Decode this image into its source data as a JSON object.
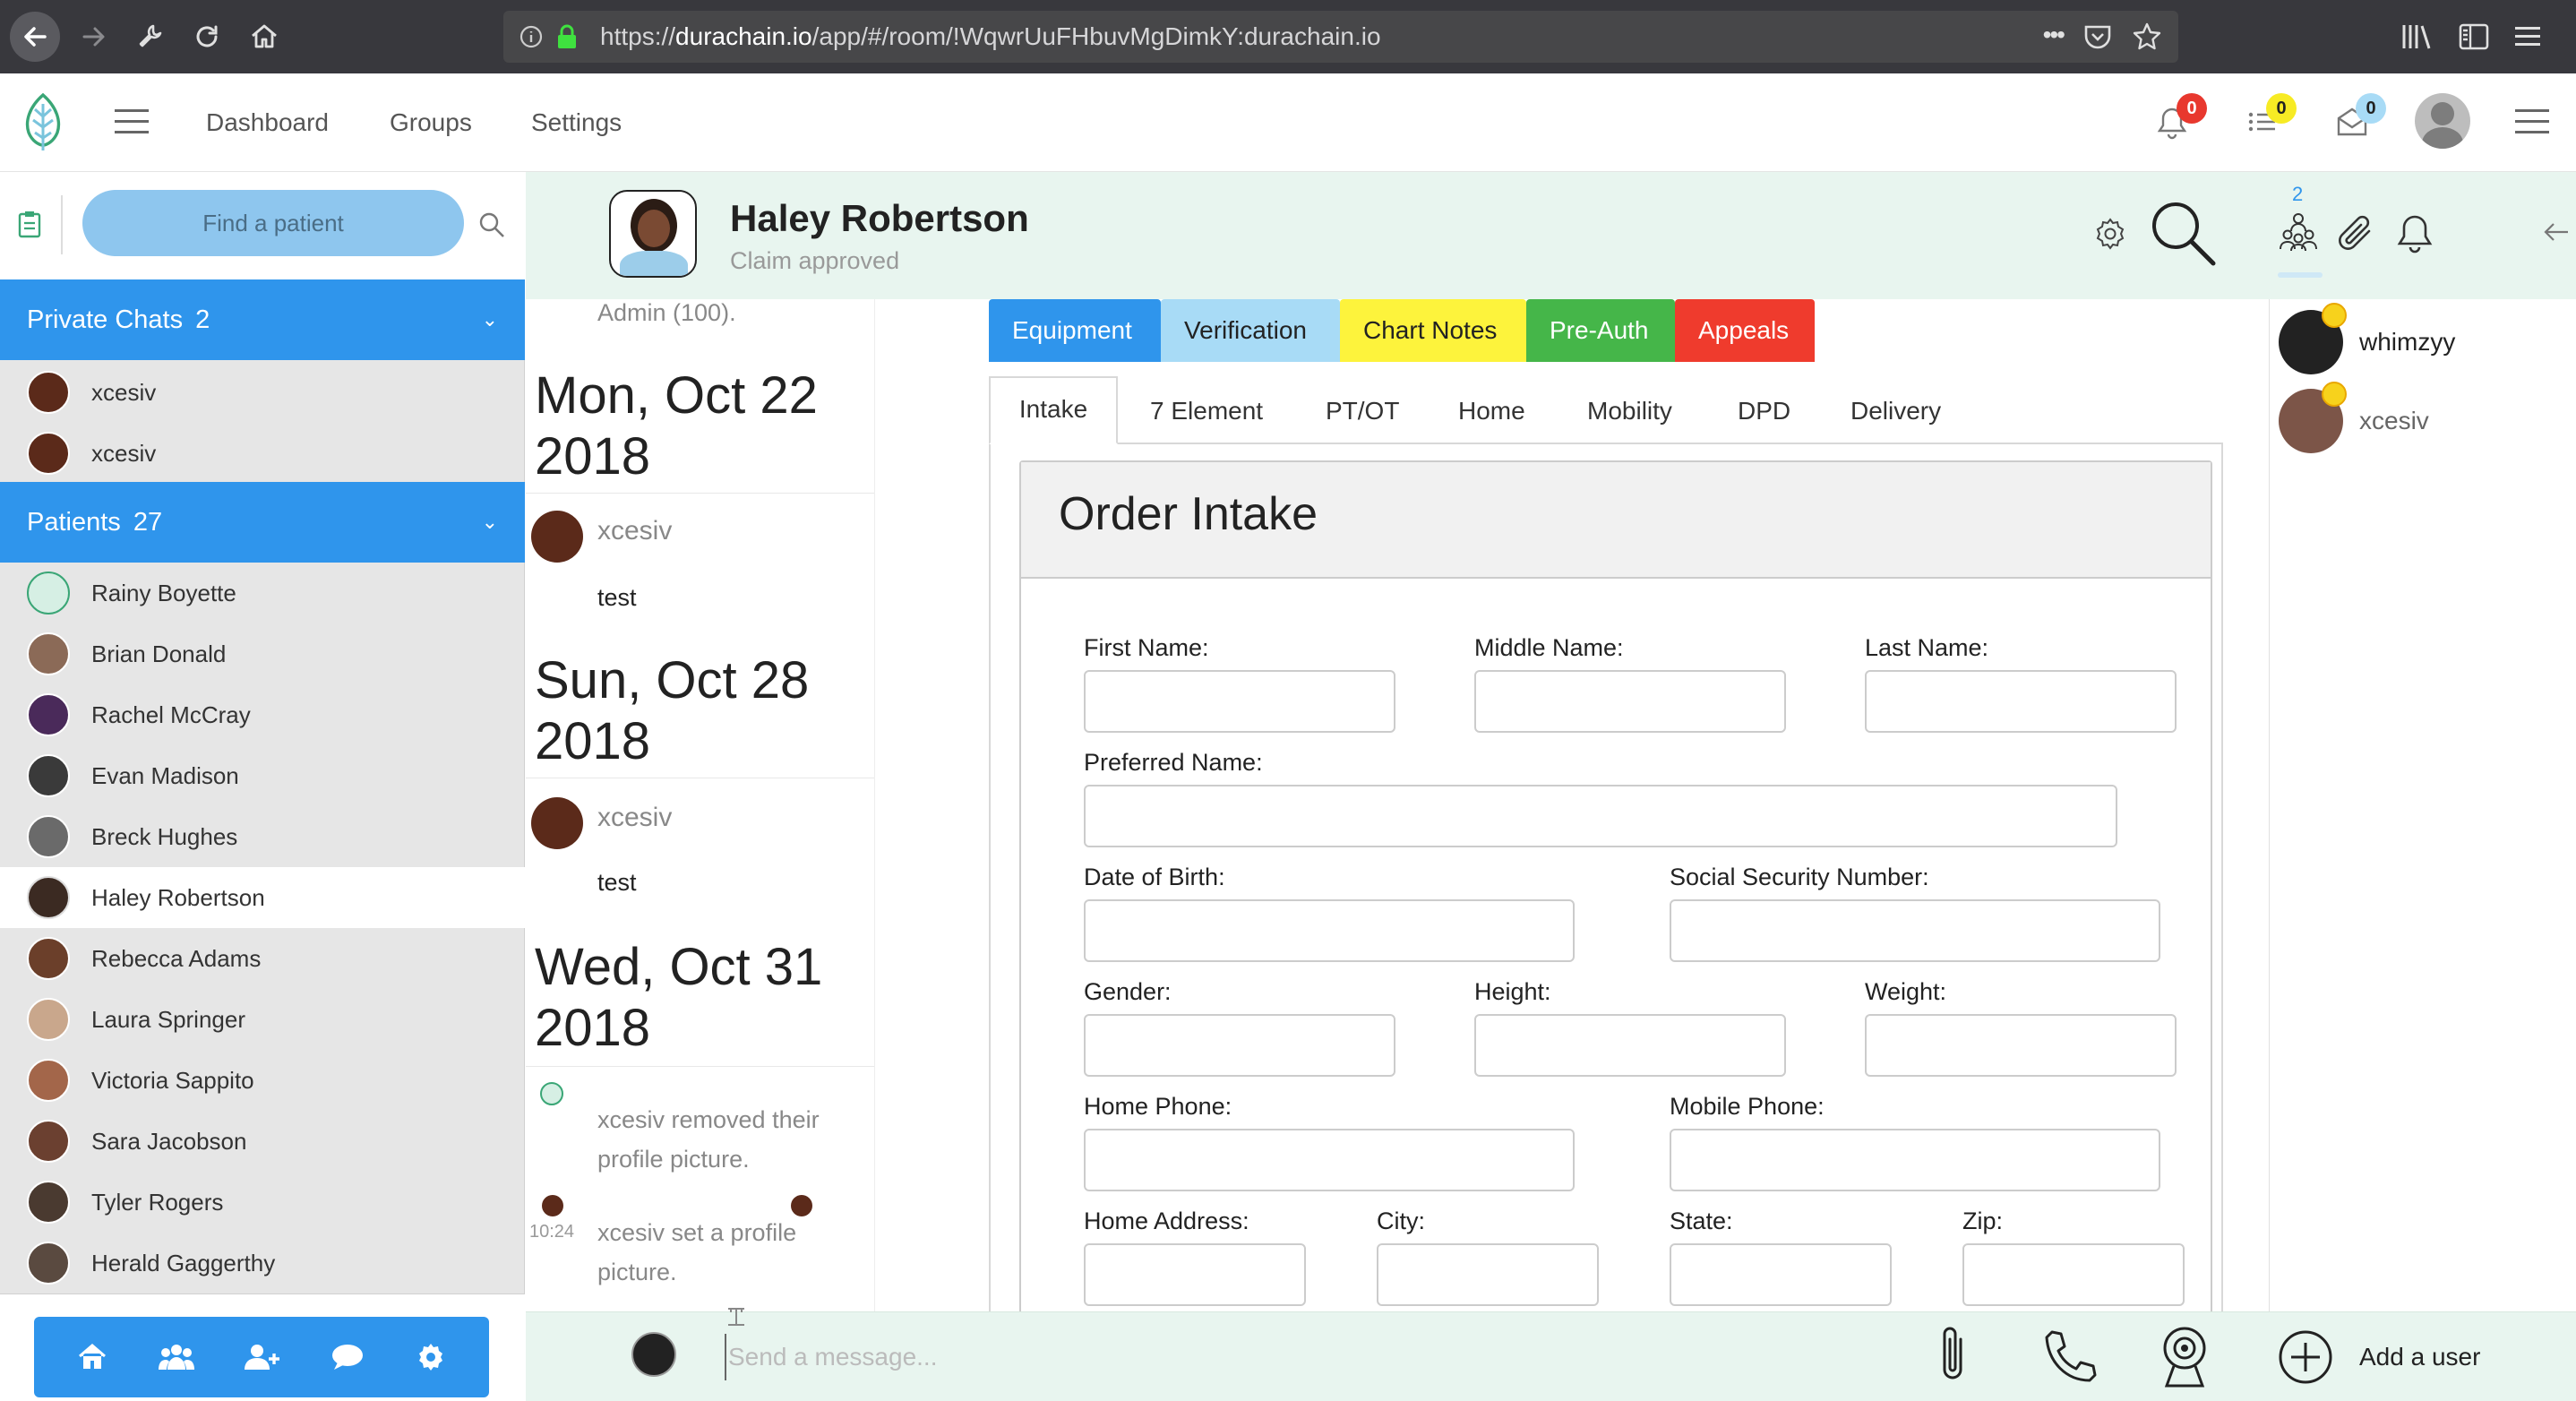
{
  "browser": {
    "url_prefix": "https://",
    "url_host": "durachain.io",
    "url_path": "/app/#/room/!WqwrUuFHbuvMgDimkY:durachain.io"
  },
  "nav": {
    "links": [
      "Dashboard",
      "Groups",
      "Settings"
    ],
    "notifications_count": "0",
    "tasks_count": "0",
    "messages_count": "0"
  },
  "sidebar": {
    "search_label": "Find a patient",
    "private_chats": {
      "label": "Private Chats",
      "count": "2",
      "items": [
        "xcesiv",
        "xcesiv"
      ]
    },
    "patients": {
      "label": "Patients",
      "count": "27",
      "items": [
        "Rainy Boyette",
        "Brian Donald",
        "Rachel McCray",
        "Evan Madison",
        "Breck Hughes",
        "Haley Robertson",
        "Rebecca Adams",
        "Laura Springer",
        "Victoria Sappito",
        "Sara Jacobson",
        "Tyler Rogers",
        "Herald Gaggerthy"
      ],
      "active": "Haley Robertson"
    }
  },
  "room": {
    "name": "Haley Robertson",
    "topic": "Claim approved",
    "member_count": "2"
  },
  "timeline": {
    "partial_top": "Admin (100).",
    "groups": [
      {
        "date": "Mon, Oct 22 2018",
        "sender": "xcesiv",
        "message": "test"
      },
      {
        "date": "Sun, Oct 28 2018",
        "sender": "xcesiv",
        "message": "test"
      },
      {
        "date": "Wed, Oct 31 2018"
      }
    ],
    "notice_1": "xcesiv removed their profile picture.",
    "notice_2_time": "10:24",
    "notice_2": "xcesiv set a profile picture."
  },
  "widget": {
    "category_tabs": [
      {
        "label": "Equipment",
        "color": "#2f95ec"
      },
      {
        "label": "Verification",
        "color": "#a8dbf6"
      },
      {
        "label": "Chart Notes",
        "color": "#fdf33c"
      },
      {
        "label": "Pre-Auth",
        "color": "#45b649"
      },
      {
        "label": "Appeals",
        "color": "#ef3b2d"
      }
    ],
    "sub_tabs": [
      "Intake",
      "7 Element",
      "PT/OT",
      "Home",
      "Mobility",
      "DPD",
      "Delivery"
    ],
    "form_title": "Order Intake",
    "fields": {
      "first_name": "First Name:",
      "middle_name": "Middle Name:",
      "last_name": "Last Name:",
      "preferred_name": "Preferred Name:",
      "dob": "Date of Birth:",
      "ssn": "Social Security Number:",
      "gender": "Gender:",
      "height": "Height:",
      "weight": "Weight:",
      "home_phone": "Home Phone:",
      "mobile_phone": "Mobile Phone:",
      "home_address": "Home Address:",
      "city": "City:",
      "state": "State:",
      "zip": "Zip:"
    }
  },
  "members": [
    "whimzyy",
    "xcesiv"
  ],
  "composer": {
    "placeholder": "Send a message...",
    "add_user": "Add a user"
  }
}
